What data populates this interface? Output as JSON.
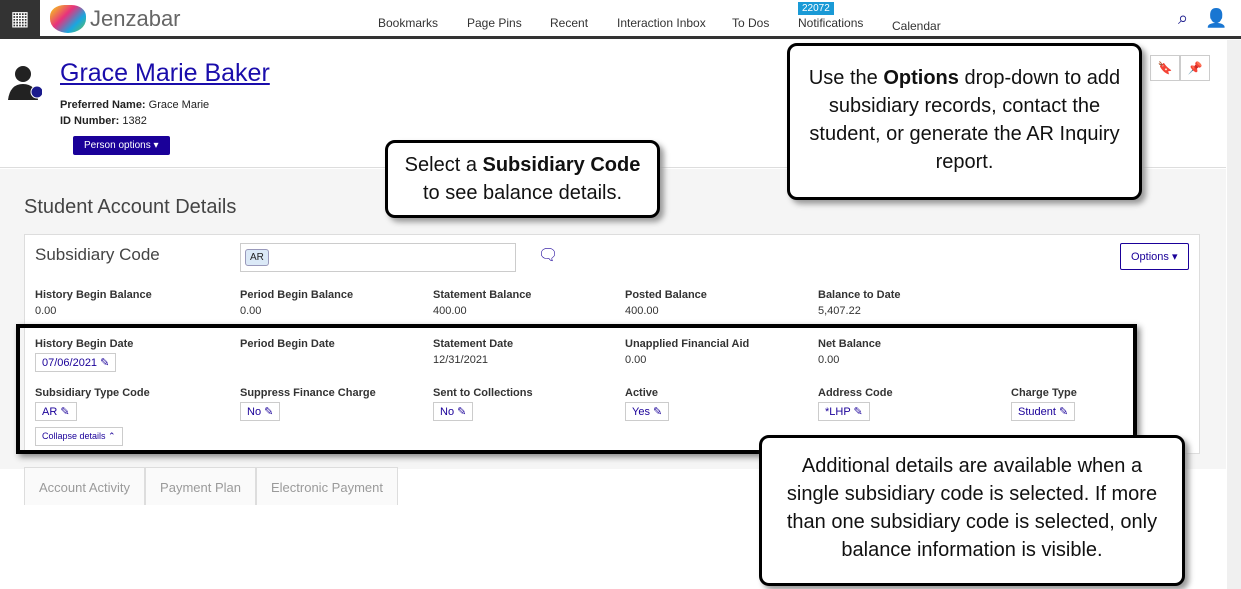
{
  "topbar": {
    "logo": "Jenzabar",
    "nav": [
      "Bookmarks",
      "Page Pins",
      "Recent",
      "Interaction Inbox",
      "To Dos",
      "Notifications",
      "Calendar"
    ],
    "notifications_count": "22072"
  },
  "person": {
    "name": "Grace Marie Baker",
    "preferred_label": "Preferred Name:",
    "preferred": "Grace Marie",
    "id_label": "ID Number:",
    "id": "1382",
    "options": "Person options ▾"
  },
  "page": {
    "title": "Student Account Details",
    "subsidiary_label": "Subsidiary Code",
    "chip": "AR",
    "options": "Options ▾",
    "collapse": "Collapse details ⌃"
  },
  "balances": [
    {
      "label": "History Begin Balance",
      "value": "0.00"
    },
    {
      "label": "Period Begin Balance",
      "value": "0.00"
    },
    {
      "label": "Statement Balance",
      "value": "400.00"
    },
    {
      "label": "Posted Balance",
      "value": "400.00"
    },
    {
      "label": "Balance to Date",
      "value": "5,407.22"
    }
  ],
  "details": [
    {
      "label": "History Begin Date",
      "value": "07/06/2021 ✎"
    },
    {
      "label": "Period Begin Date",
      "value": ""
    },
    {
      "label": "Statement Date",
      "value": "12/31/2021"
    },
    {
      "label": "Unapplied Financial Aid",
      "value": "0.00"
    },
    {
      "label": "Net Balance",
      "value": "0.00"
    }
  ],
  "codes": [
    {
      "label": "Subsidiary Type Code",
      "value": "AR ✎"
    },
    {
      "label": "Suppress Finance Charge",
      "value": "No ✎"
    },
    {
      "label": "Sent to Collections",
      "value": "No ✎"
    },
    {
      "label": "Active",
      "value": "Yes ✎"
    },
    {
      "label": "Address Code",
      "value": "*LHP ✎"
    },
    {
      "label": "Charge Type",
      "value": "Student ✎"
    }
  ],
  "tabs": [
    "Account Activity",
    "Payment Plan",
    "Electronic Payment"
  ],
  "callouts": {
    "sub_code": "Select a <b>Subsidiary Code</b> to see balance details.",
    "options": "Use the <b>Options</b> drop-down to add subsidiary records, contact the student, or generate the AR Inquiry report.",
    "details": "Additional details are available when a single subsidiary code is selected. If more than one subsidiary code is selected, only balance information is visible."
  }
}
